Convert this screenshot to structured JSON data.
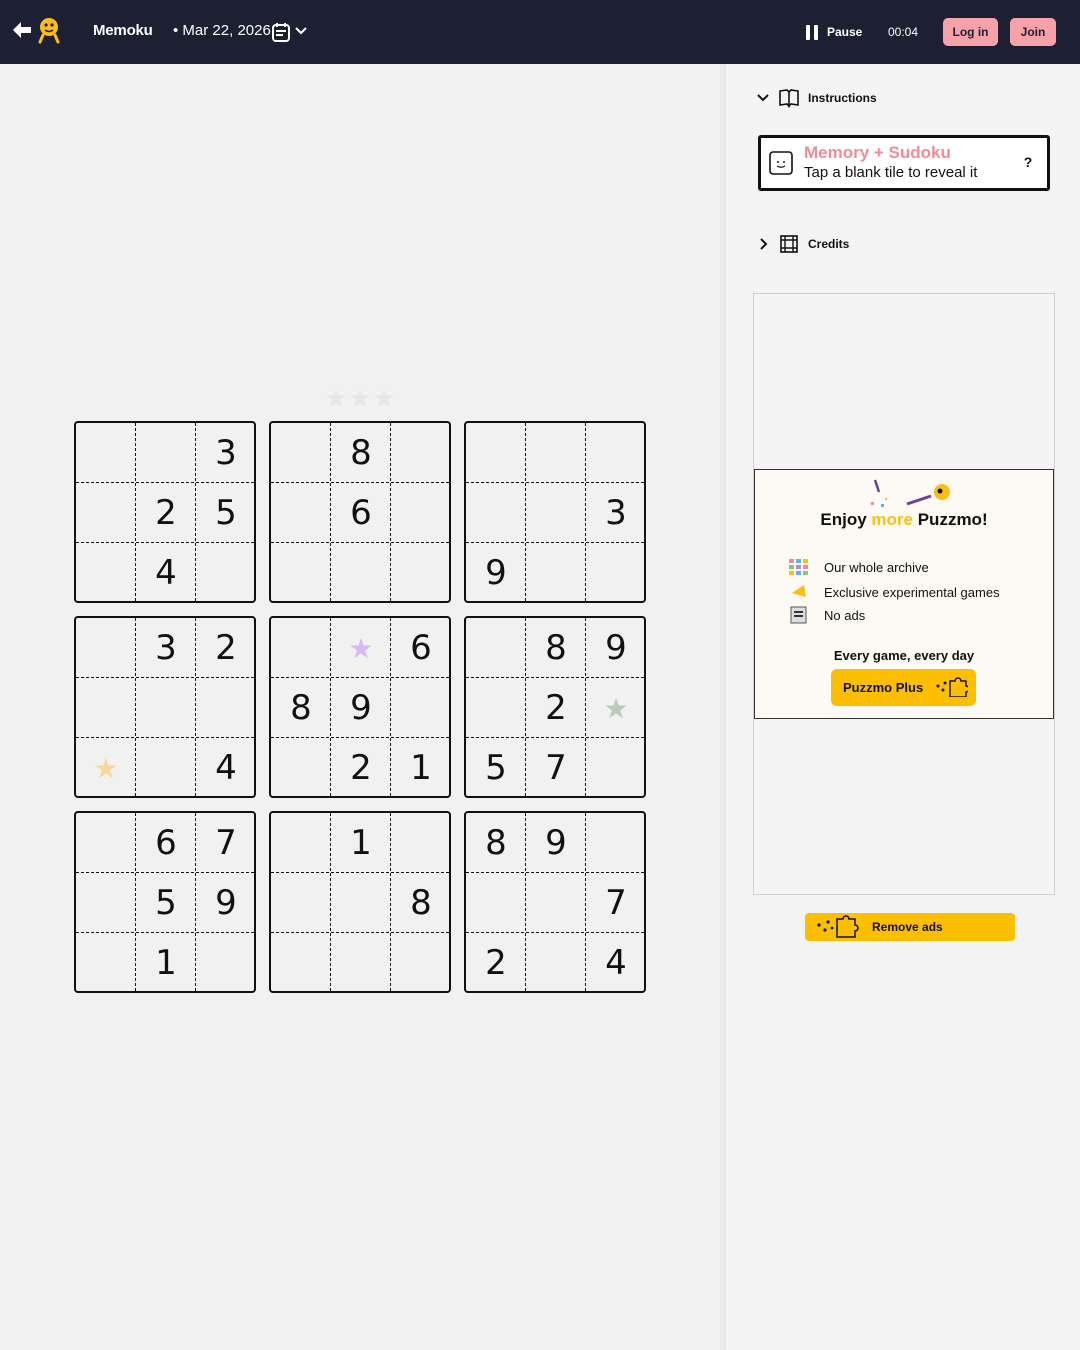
{
  "header": {
    "game_title": "Memoku",
    "date": "• Mar 22, 2026",
    "pause_label": "Pause",
    "timer": "00:04",
    "login_label": "Log in",
    "join_label": "Join",
    "colors": {
      "bar": "#1d2032",
      "button": "#f7a1a8"
    },
    "icons": [
      "back-arrow-icon",
      "puzzmo-logo-icon",
      "calendar-icon",
      "chevron-down-icon",
      "pause-icon"
    ]
  },
  "sidebar": {
    "instructions_label": "Instructions",
    "credits_label": "Credits",
    "card": {
      "title": "Memory + Sudoku",
      "subtitle": "Tap a blank tile to reveal it",
      "help": "?"
    },
    "promo": {
      "title_a": "Enjoy",
      "title_more": "more",
      "title_b": "Puzzmo!",
      "perks": [
        "Our whole archive",
        "Exclusive experimental games",
        "No ads"
      ],
      "tagline": "Every game, every day",
      "button": "Puzzmo Plus"
    },
    "remove_ads": "Remove ads"
  },
  "board": {
    "boxes": [
      [
        "",
        "",
        "3",
        "",
        "2",
        "5",
        "",
        "4",
        ""
      ],
      [
        "",
        "8",
        "",
        "",
        "6",
        "",
        "",
        "",
        ""
      ],
      [
        "",
        "",
        "",
        "",
        "",
        "3",
        "9",
        "",
        ""
      ],
      [
        "",
        "3",
        "2",
        "",
        "",
        "",
        "★",
        "",
        "4"
      ],
      [
        "",
        "★",
        "6",
        "8",
        "9",
        "",
        "",
        "2",
        "1"
      ],
      [
        "",
        "8",
        "9",
        "",
        "2",
        "★",
        "5",
        "7",
        ""
      ],
      [
        "",
        "6",
        "7",
        "",
        "5",
        "9",
        "",
        "1",
        ""
      ],
      [
        "",
        "1",
        "",
        "",
        "",
        "8",
        "",
        "",
        ""
      ],
      [
        "8",
        "9",
        "",
        "",
        "",
        "7",
        "2",
        "",
        "4"
      ]
    ],
    "star_colors": {
      "3-6": "#f7d79a",
      "4-1": "#d9b8f5",
      "5-5": "#bccbb7"
    },
    "progress_stars": {
      "earned": 0,
      "total": 3
    }
  }
}
